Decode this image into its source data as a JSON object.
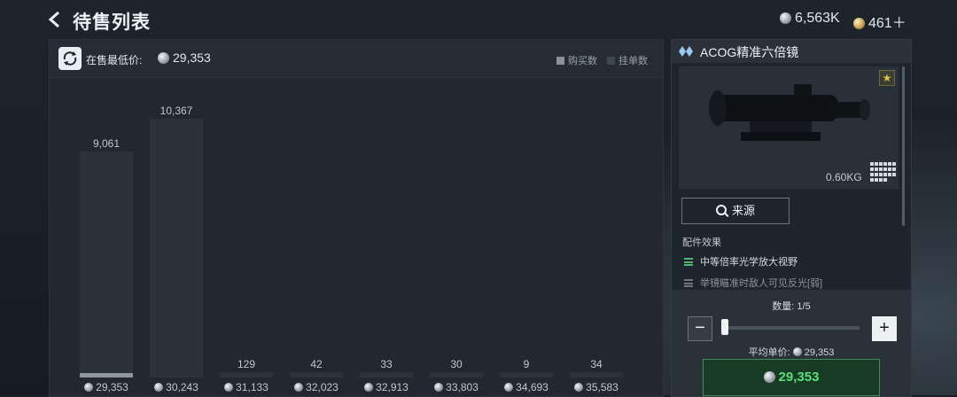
{
  "header": {
    "title": "待售列表",
    "currency_silver": "6,563K",
    "currency_gold": "461＋"
  },
  "chart_panel": {
    "lowest_label": "在售最低价:",
    "lowest_value": "29,353",
    "legend_buy": "购买数",
    "legend_list": "挂单数"
  },
  "chart_data": {
    "type": "bar",
    "categories": [
      "29,353",
      "30,243",
      "31,133",
      "32,023",
      "32,913",
      "33,803",
      "34,693",
      "35,583"
    ],
    "series": [
      {
        "name": "挂单数",
        "values": [
          9061,
          10367,
          129,
          42,
          33,
          30,
          9,
          34
        ]
      },
      {
        "name": "购买数",
        "values": [
          180,
          0,
          0,
          0,
          0,
          0,
          0,
          0
        ]
      }
    ],
    "labels": [
      "9,061",
      "10,367",
      "129",
      "42",
      "33",
      "30",
      "9",
      "34"
    ],
    "ylim": [
      0,
      11000
    ],
    "legend": "top-right"
  },
  "item": {
    "name": "ACOG精准六倍镜",
    "weight": "0.60KG",
    "source_button": "来源",
    "effects_title": "配件效果",
    "effects": [
      "中等倍率光学放大视野",
      "举镜瞄准时敌人可见反光[弱]"
    ],
    "quantity_label": "数量: 1/5",
    "quantity": 1,
    "quantity_max": 5,
    "avg_label": "平均单价:",
    "avg_value": "29,353",
    "buy_total": "29,353"
  },
  "colors": {
    "accent_green": "#5ae07a",
    "bar": "#2b323b",
    "bar_fill": "#8e969f"
  }
}
